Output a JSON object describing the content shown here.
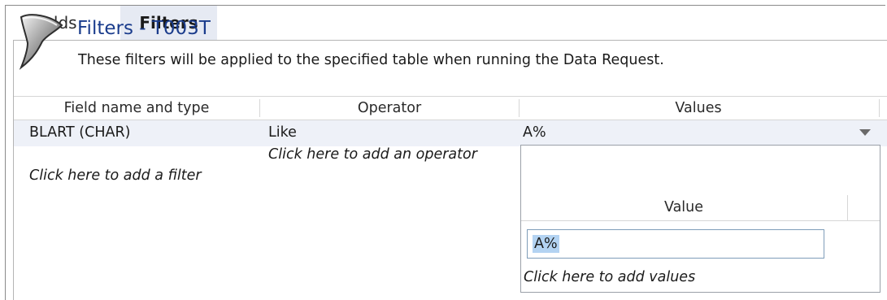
{
  "tabs": [
    {
      "label": "Fields",
      "active": false
    },
    {
      "label": "Filters",
      "active": true
    }
  ],
  "header": {
    "icon": "funnel-icon",
    "title": "Filters - T003T",
    "subtitle": "These filters will be applied to the specified table when running the Data Request."
  },
  "grid": {
    "columns": [
      "Field name and type",
      "Operator",
      "Values"
    ],
    "rows": [
      {
        "field": "BLART  (CHAR)",
        "operator": "Like",
        "value": "A%"
      }
    ],
    "add_filter_hint": "Click here to add a filter",
    "add_operator_hint": "Click here to add an operator"
  },
  "values_popup": {
    "column_header": "Value",
    "input_value": "A%",
    "add_values_hint": "Click here to add values"
  },
  "colors": {
    "active_tab_bg": "#e6eaf3",
    "title": "#1a3c8c",
    "selected_row_bg": "#eef1f8",
    "text_selection": "#b3d3f2"
  }
}
